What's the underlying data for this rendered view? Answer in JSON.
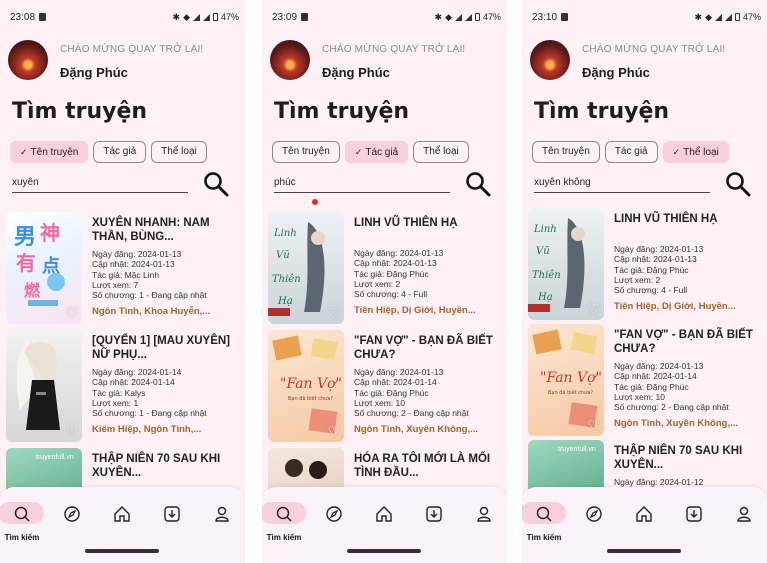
{
  "screens": [
    {
      "time": "23:08",
      "battery": "47%",
      "welcome": "CHÀO MỪNG QUAY TRỞ LẠI!",
      "username": "Đặng Phúc",
      "title": "Tìm truyện",
      "chips": [
        "Tên truyện",
        "Tác giả",
        "Thể loại"
      ],
      "selected_chip": 0,
      "search_value": "xuyên",
      "results": [
        {
          "title": "XUYÊN NHANH: NAM THẦN, BÙNG...",
          "ngay_dang": "Ngày đăng: 2024-01-13",
          "cap_nhat": "Cập nhật: 2024-01-13",
          "tac_gia": "Tác giả: Mặc Linh",
          "luot_xem": "Lượt xem: 7",
          "so_chuong": "Số chương: 1 - Đang cập nhật",
          "genres": "Ngôn Tình, Khoa Huyễn,...",
          "cover": "pink"
        },
        {
          "title": "[QUYỂN 1] [MAU XUYÊN] NỮ PHỤ...",
          "ngay_dang": "Ngày đăng: 2024-01-14",
          "cap_nhat": "Cập nhật: 2024-01-14",
          "tac_gia": "Tác giả: Kalys",
          "luot_xem": "Lượt xem: 1",
          "so_chuong": "Số chương: 1 - Đang cập nhật",
          "genres": "Kiếm Hiệp, Ngôn Tình,...",
          "cover": "girl"
        },
        {
          "title": "THẬP NIÊN 70 SAU KHI XUYÊN...",
          "ngay_dang": "",
          "cap_nhat": "",
          "tac_gia": "",
          "luot_xem": "",
          "so_chuong": "",
          "genres": "",
          "cover": "green"
        }
      ],
      "nav_label": "Tìm kiếm"
    },
    {
      "time": "23:09",
      "battery": "47%",
      "welcome": "CHÀO MỪNG QUAY TRỞ LẠI!",
      "username": "Đặng Phúc",
      "title": "Tìm truyện",
      "chips": [
        "Tên truyện",
        "Tác giả",
        "Thể loại"
      ],
      "selected_chip": 1,
      "search_value": "phúc",
      "results": [
        {
          "title": "LINH VŨ THIÊN HẠ",
          "ngay_dang": "Ngày đăng: 2024-01-13",
          "cap_nhat": "Cập nhật: 2024-01-13",
          "tac_gia": "Tác giả: Đặng Phúc",
          "luot_xem": "Lượt xem: 2",
          "so_chuong": "Số chương: 4 - Full",
          "genres": "Tiên Hiệp, Dị Giới, Huyền...",
          "cover": "linh"
        },
        {
          "title": "\"FAN VỢ\" - BẠN ĐÃ BIẾT CHƯA?",
          "ngay_dang": "Ngày đăng: 2024-01-13",
          "cap_nhat": "Cập nhật: 2024-01-14",
          "tac_gia": "Tác giả: Đặng Phúc",
          "luot_xem": "Lượt xem: 10",
          "so_chuong": "Số chương: 2 - Đang cập nhật",
          "genres": "Ngôn Tình, Xuyên Không,...",
          "cover": "fan"
        },
        {
          "title": "HÓA RA TÔI MỚI LÀ MỐI TÌNH ĐẦU...",
          "ngay_dang": "",
          "cap_nhat": "",
          "tac_gia": "",
          "luot_xem": "",
          "so_chuong": "",
          "genres": "",
          "cover": "couple"
        }
      ],
      "nav_label": "Tìm kiếm"
    },
    {
      "time": "23:10",
      "battery": "47%",
      "welcome": "CHÀO MỪNG QUAY TRỞ LẠI!",
      "username": "Đặng Phúc",
      "title": "Tìm truyện",
      "chips": [
        "Tên truyện",
        "Tác giả",
        "Thể loại"
      ],
      "selected_chip": 2,
      "search_value": "xuyên không",
      "results": [
        {
          "title": "LINH VŨ THIÊN HẠ",
          "ngay_dang": "Ngày đăng: 2024-01-13",
          "cap_nhat": "Cập nhật: 2024-01-13",
          "tac_gia": "Tác giả: Đặng Phúc",
          "luot_xem": "Lượt xem: 2",
          "so_chuong": "Số chương: 4 - Full",
          "genres": "Tiên Hiệp, Dị Giới, Huyền...",
          "cover": "linh"
        },
        {
          "title": "\"FAN VỢ\" - BẠN ĐÃ BIẾT CHƯA?",
          "ngay_dang": "Ngày đăng: 2024-01-13",
          "cap_nhat": "Cập nhật: 2024-01-14",
          "tac_gia": "Tác giả: Đặng Phúc",
          "luot_xem": "Lượt xem: 10",
          "so_chuong": "Số chương: 2 - Đang cập nhật",
          "genres": "Ngôn Tình, Xuyên Không,...",
          "cover": "fan"
        },
        {
          "title": "THẬP NIÊN 70 SAU KHI XUYÊN...",
          "ngay_dang": "Ngày đăng: 2024-01-12",
          "cap_nhat": "",
          "tac_gia": "",
          "luot_xem": "",
          "so_chuong": "",
          "genres": "",
          "cover": "green"
        }
      ],
      "nav_label": "Tìm kiếm"
    }
  ],
  "colors": {
    "background": "#fdf1f5",
    "chip_selected": "#f8cfdd",
    "genre": "#a2622b",
    "navbar": "#fbf3f8"
  },
  "nav_icons": [
    "search-icon",
    "compass-icon",
    "home-icon",
    "download-icon",
    "profile-icon"
  ]
}
